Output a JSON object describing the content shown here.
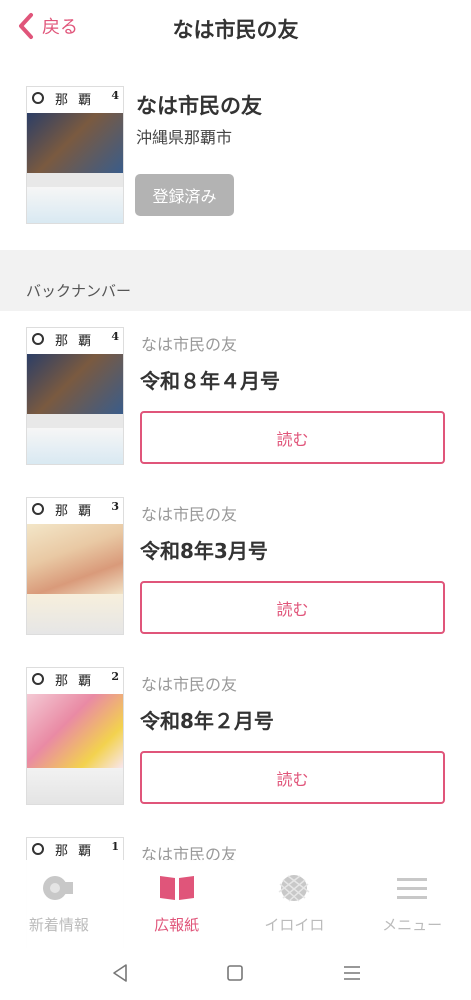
{
  "header": {
    "back_label": "戻る",
    "title": "なは市民の友"
  },
  "subscription": {
    "name": "なは市民の友",
    "city": "沖縄県那覇市",
    "button_label": "登録済み",
    "cover": {
      "title": "那 覇",
      "number": "4"
    }
  },
  "section": {
    "label": "バックナンバー"
  },
  "backnumbers": [
    {
      "publisher": "なは市民の友",
      "issue": "令和８年４月号",
      "read_label": "読む",
      "cover": {
        "title": "那 覇",
        "number": "4"
      }
    },
    {
      "publisher": "なは市民の友",
      "issue": "令和8年3月号",
      "read_label": "読む",
      "cover": {
        "title": "那 覇",
        "number": "3"
      }
    },
    {
      "publisher": "なは市民の友",
      "issue": "令和8年２月号",
      "read_label": "読む",
      "cover": {
        "title": "那 覇",
        "number": "2"
      }
    },
    {
      "publisher": "なは市民の友",
      "cover": {
        "title": "那 覇",
        "number": "1"
      }
    }
  ],
  "tabs": [
    {
      "label": "新着情報",
      "icon": "speaker-icon"
    },
    {
      "label": "広報紙",
      "icon": "open-book-icon"
    },
    {
      "label": "イロイロ",
      "icon": "ball-icon"
    },
    {
      "label": "メニュー",
      "icon": "hamburger-icon"
    }
  ],
  "colors": {
    "accent": "#e0557a",
    "inactive": "#bbbbbb",
    "section_bg": "#f2f2f2",
    "registered_bg": "#b3b3b3"
  }
}
